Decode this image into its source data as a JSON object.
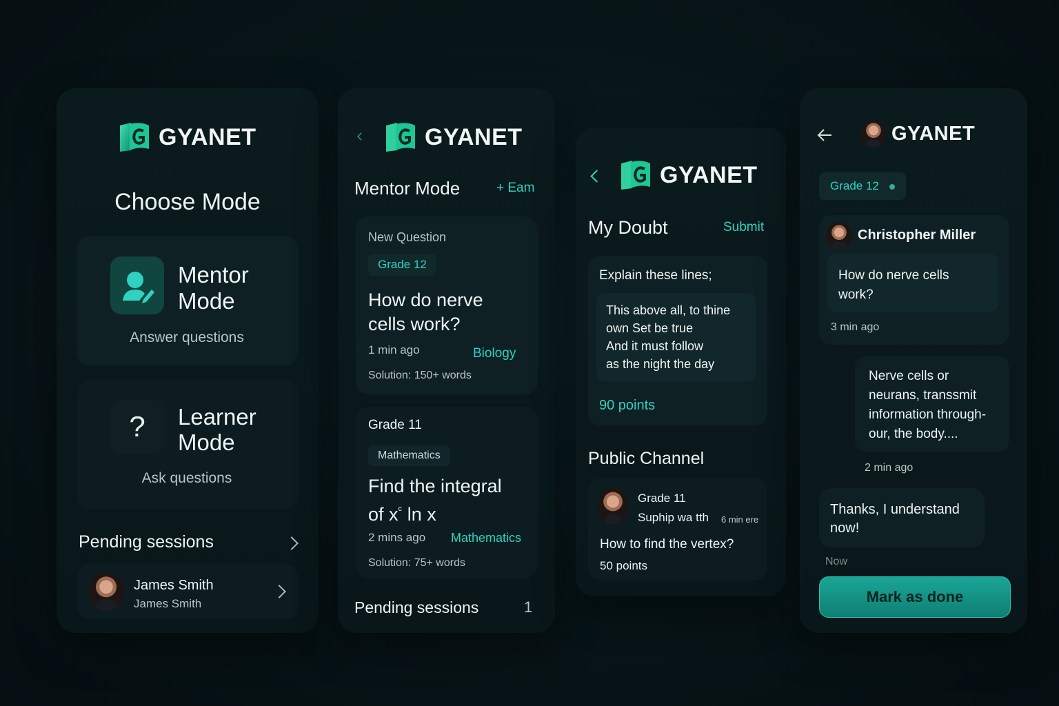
{
  "brand": {
    "name": "GYANET",
    "accent": "#2fd2c0"
  },
  "screen1": {
    "title": "Choose Mode",
    "mentor": {
      "title_line1": "Mentor",
      "title_line2": "Mode",
      "subtitle": "Answer questions",
      "icon": "mentor-person-icon"
    },
    "learner": {
      "title_line1": "Learner",
      "title_line2": "Mode",
      "subtitle": "Ask questions",
      "icon": "question-mark-icon"
    },
    "pending_label": "Pending sessions",
    "session": {
      "name": "James Smith",
      "subtitle": "James Smith"
    }
  },
  "screen2": {
    "title": "Mentor Mode",
    "action": "+ Eam",
    "q1": {
      "tag": "New Question",
      "grade": "Grade 12",
      "title_line1": "How do nerve",
      "title_line2": "cells work?",
      "time": "1 min ago",
      "subject": "Biology",
      "solution": "Solution: 150+ words"
    },
    "q2": {
      "grade": "Grade 11",
      "subject_chip": "Mathematics",
      "title_line1": "Find the integral",
      "title_line2_a": "of x",
      "title_line2_sup": "ᶜ",
      "title_line2_b": " ln x",
      "time": "2 mins ago",
      "subject": "Mathematics",
      "solution": "Solution: 75+ words"
    },
    "pending_label": "Pending sessions",
    "pending_count": "1"
  },
  "screen3": {
    "title": "My Doubt",
    "submit": "Submit",
    "prompt": "Explain these lines;",
    "quote": [
      "This above all, to thine",
      "own Set be true",
      "And it must follow",
      "as the night the day"
    ],
    "points": "90 points",
    "channel_title": "Public Channel",
    "post": {
      "grade": "Grade 11",
      "author": "Suphip wa tth",
      "time": "6 min ere",
      "question": "How to find the vertex?",
      "points": "50 points"
    }
  },
  "screen4": {
    "grade_chip": "Grade 12",
    "user": "Christopher Miller",
    "msg1_line1": "How do nerve cells",
    "msg1_line2": "work?",
    "msg1_time": "3 min ago",
    "reply": [
      "Nerve cells  or",
      "neurans, transsmit",
      "information through-",
      "our,  the body...."
    ],
    "reply_time": "2 min ago",
    "msg3_line1": "Thanks, I understand",
    "msg3_line2": "now!",
    "msg3_time": "Now",
    "button": "Mark as done"
  }
}
